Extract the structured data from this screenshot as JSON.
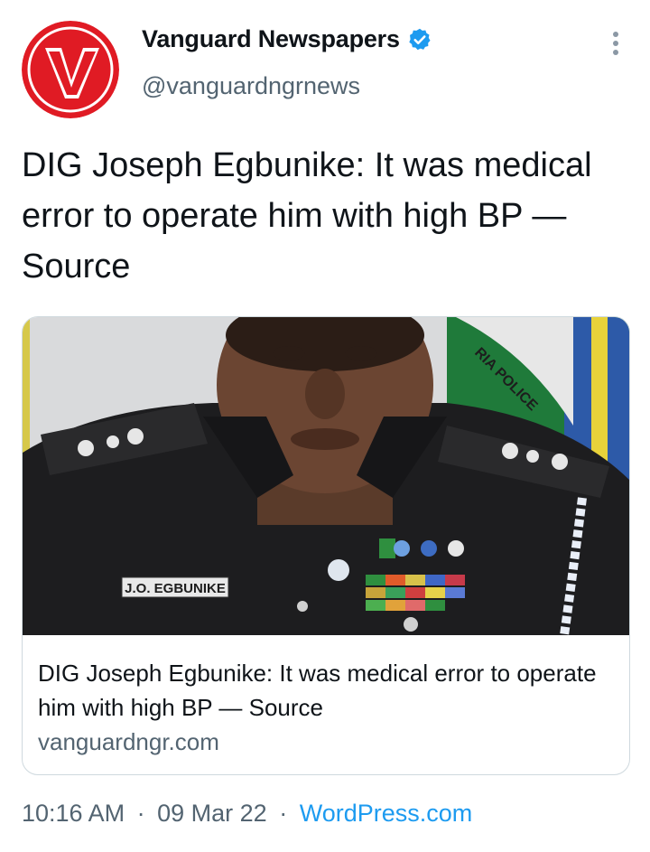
{
  "author": {
    "display_name": "Vanguard Newspapers",
    "handle": "@vanguardngrnews",
    "avatar_letter": "V",
    "avatar_color": "#e01b24",
    "verified_color": "#1d9bf0"
  },
  "tweet": {
    "text": "DIG Joseph Egbunike: It was medical error to operate him with high BP — Source"
  },
  "card": {
    "image_label": "J.O. EGBUNIKE",
    "flag_text": "RIA POLICE",
    "title": "DIG Joseph Egbunike: It was medical error to operate him with high BP — Source",
    "domain": "vanguardngr.com"
  },
  "meta": {
    "time": "10:16 AM",
    "date": "09 Mar 22",
    "source": "WordPress.com",
    "separator": "·"
  }
}
